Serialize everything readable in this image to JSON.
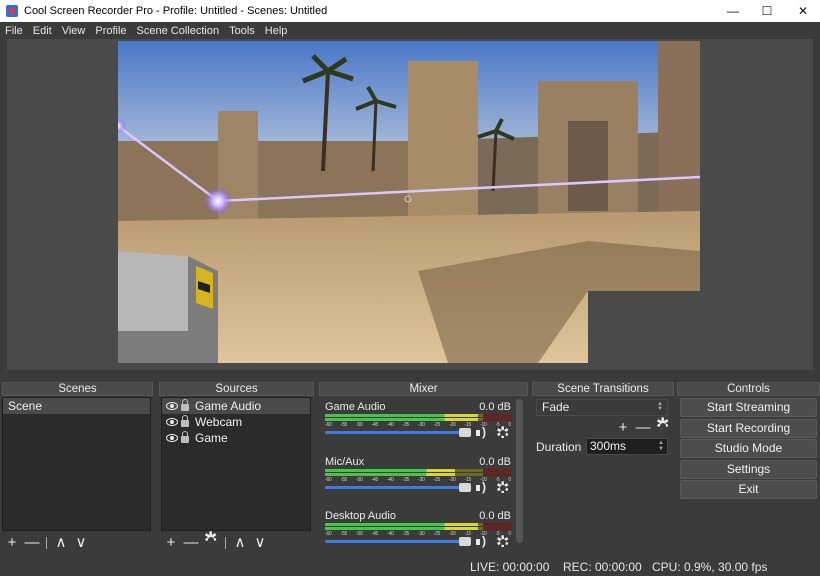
{
  "window": {
    "title": "Cool Screen Recorder Pro  - Profile: Untitled - Scenes: Untitled",
    "minimize": "—",
    "maximize": "☐",
    "close": "✕"
  },
  "menu": [
    "File",
    "Edit",
    "View",
    "Profile",
    "Scene Collection",
    "Tools",
    "Help"
  ],
  "scenes": {
    "header": "Scenes",
    "items": [
      "Scene"
    ]
  },
  "sources": {
    "header": "Sources",
    "items": [
      "Game Audio",
      "Webcam",
      "Game"
    ]
  },
  "mixer": {
    "header": "Mixer",
    "channels": [
      {
        "name": "Game Audio",
        "db": "0.0 dB",
        "level": 0.82
      },
      {
        "name": "Mic/Aux",
        "db": "0.0 dB",
        "level": 0.7
      },
      {
        "name": "Desktop Audio",
        "db": "0.0 dB",
        "level": 0.82
      }
    ],
    "ticks": [
      "-60",
      "-55",
      "-50",
      "-45",
      "-40",
      "-35",
      "-30",
      "-25",
      "-20",
      "-15",
      "-10",
      "-5",
      "0"
    ]
  },
  "transitions": {
    "header": "Scene Transitions",
    "selected": "Fade",
    "duration_label": "Duration",
    "duration_value": "300ms"
  },
  "controls": {
    "header": "Controls",
    "start_streaming": "Start Streaming",
    "start_recording": "Start Recording",
    "studio_mode": "Studio Mode",
    "settings": "Settings",
    "exit": "Exit"
  },
  "status": {
    "live": "LIVE: 00:00:00",
    "rec": "REC: 00:00:00",
    "cpu": "CPU: 0.9%, 30.00 fps"
  },
  "icons": {
    "plus": "+",
    "minus": "—",
    "up": "∧",
    "down": "∨"
  },
  "colors": {
    "accent_blue": "#3c7de4",
    "panel_bg": "#3b3b3b",
    "list_bg": "#2b2b2b"
  }
}
